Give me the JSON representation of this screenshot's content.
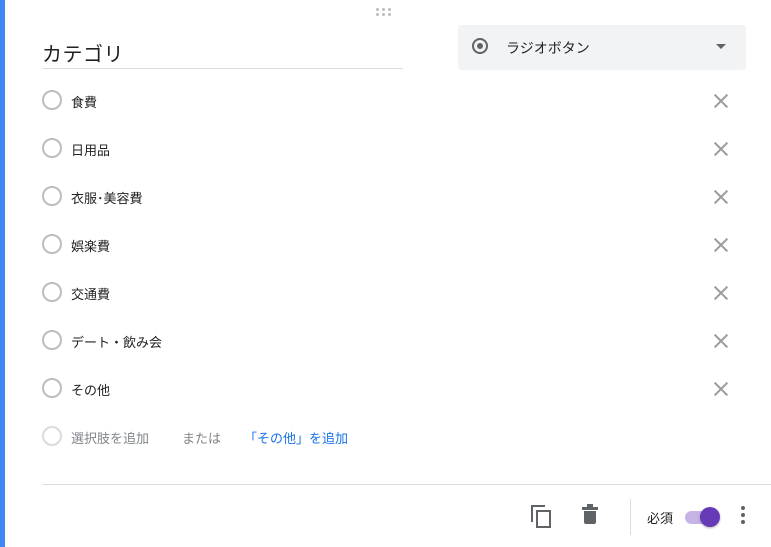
{
  "question": {
    "title": "カテゴリ",
    "type_label": "ラジオボタン"
  },
  "options": [
    {
      "label": "食費"
    },
    {
      "label": "日用品"
    },
    {
      "label": "衣服･美容費"
    },
    {
      "label": "娯楽費"
    },
    {
      "label": "交通費"
    },
    {
      "label": "デート・飲み会"
    },
    {
      "label": "その他"
    }
  ],
  "add_option": {
    "add_label": "選択肢を追加",
    "or_label": "または",
    "add_other_label": "「その他」を追加"
  },
  "footer": {
    "required_label": "必須",
    "required_on": true
  },
  "colors": {
    "accent": "#4285f4",
    "toggle": "#673ab7",
    "link": "#1a73e8"
  },
  "icons": [
    "drag-handle-icon",
    "radio-button-icon",
    "dropdown-arrow-icon",
    "close-icon",
    "copy-icon",
    "trash-icon",
    "more-vert-icon"
  ]
}
